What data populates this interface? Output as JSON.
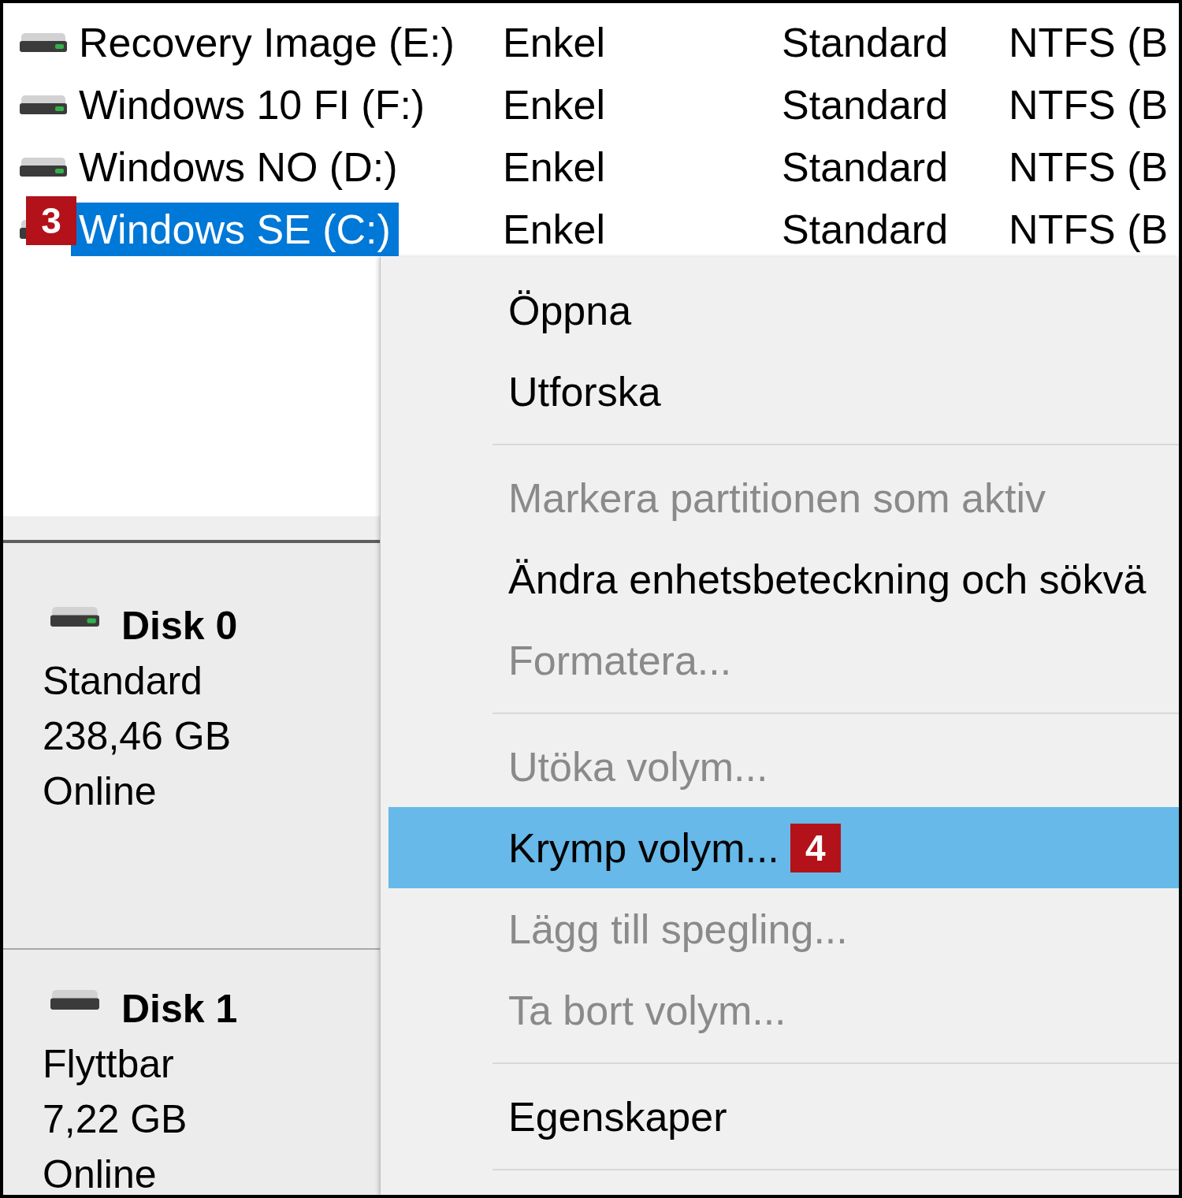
{
  "volume_list": {
    "rows": [
      {
        "cells": [
          "Recovery Image (E:)",
          "Enkel",
          "Standard",
          "NTFS (B"
        ],
        "selected": false
      },
      {
        "cells": [
          "Windows 10 FI (F:)",
          "Enkel",
          "Standard",
          "NTFS (B"
        ],
        "selected": false
      },
      {
        "cells": [
          "Windows NO (D:)",
          "Enkel",
          "Standard",
          "NTFS (B"
        ],
        "selected": false
      },
      {
        "cells": [
          "Windows SE (C:)",
          "Enkel",
          "Standard",
          "NTFS (B"
        ],
        "selected": true,
        "callout": "3"
      }
    ]
  },
  "disks": [
    {
      "title": "Disk 0",
      "kind": "fixed",
      "lines": [
        "Standard",
        "238,46 GB",
        "Online"
      ]
    },
    {
      "title": "Disk 1",
      "kind": "removable",
      "lines": [
        "Flyttbar",
        "7,22 GB",
        "Online"
      ]
    }
  ],
  "context_menu": {
    "groups": [
      {
        "items": [
          {
            "label": "Öppna",
            "disabled": false,
            "selected": false
          },
          {
            "label": "Utforska",
            "disabled": false,
            "selected": false
          }
        ]
      },
      {
        "items": [
          {
            "label": "Markera partitionen som aktiv",
            "disabled": true,
            "selected": false
          },
          {
            "label": "Ändra enhetsbeteckning och sökvä",
            "disabled": false,
            "selected": false
          },
          {
            "label": "Formatera...",
            "disabled": true,
            "selected": false
          }
        ]
      },
      {
        "items": [
          {
            "label": "Utöka volym...",
            "disabled": true,
            "selected": false
          },
          {
            "label": "Krymp volym...",
            "disabled": false,
            "selected": true,
            "callout": "4"
          },
          {
            "label": "Lägg till spegling...",
            "disabled": true,
            "selected": false
          },
          {
            "label": "Ta bort volym...",
            "disabled": true,
            "selected": false
          }
        ]
      },
      {
        "items": [
          {
            "label": "Egenskaper",
            "disabled": false,
            "selected": false
          }
        ]
      }
    ]
  }
}
